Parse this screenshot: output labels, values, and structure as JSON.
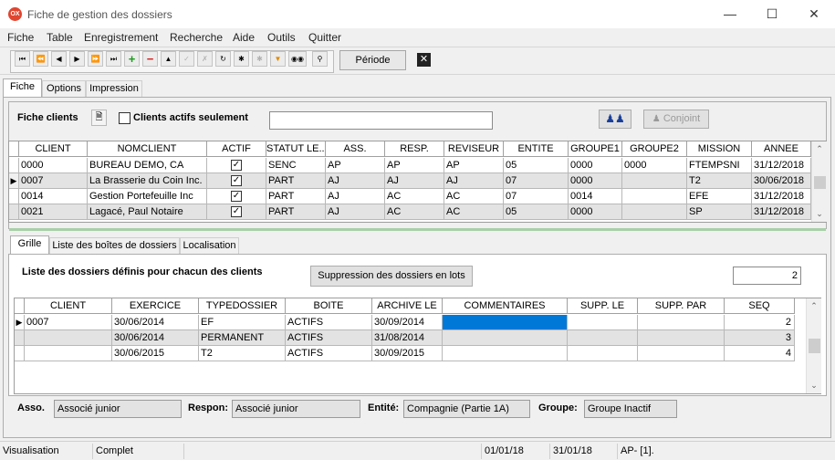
{
  "window": {
    "title": "Fiche de gestion des dossiers",
    "app_icon_text": "OX"
  },
  "menu": [
    "Fiche",
    "Table",
    "Enregistrement",
    "Recherche",
    "Aide",
    "Outils",
    "Quitter"
  ],
  "toolbar": {
    "periode_label": "Période",
    "buttons": [
      "first-icon",
      "prev-page-icon",
      "prev-icon",
      "next-icon",
      "next-page-icon",
      "last-icon",
      "add-icon",
      "delete-icon",
      "up-icon",
      "confirm-icon",
      "cancel-icon",
      "refresh-icon",
      "star-icon",
      "star-disabled-icon",
      "filter-icon",
      "binoculars-icon",
      "search-icon"
    ]
  },
  "top_tabs": [
    "Fiche",
    "Options",
    "Impression"
  ],
  "clients_panel": {
    "title": "Fiche clients",
    "actifs_label": "Clients actifs seulement",
    "conjoint_label": "Conjoint",
    "columns": [
      "CLIENT",
      "NOMCLIENT",
      "ACTIF",
      "STATUT LE...",
      "ASS.",
      "RESP.",
      "REVISEUR",
      "ENTITE",
      "GROUPE1",
      "GROUPE2",
      "MISSION",
      "ANNEE"
    ],
    "rows": [
      {
        "client": "0000",
        "nom": "BUREAU DEMO, CA",
        "actif": true,
        "statut": "SENC",
        "ass": "AP",
        "resp": "AP",
        "rev": "AP",
        "entite": "05",
        "groupe1": "0000",
        "groupe2": "0000",
        "mission": "FTEMPSNI",
        "annee": "31/12/2018"
      },
      {
        "client": "0007",
        "nom": "La Brasserie du Coin Inc.",
        "actif": true,
        "statut": "PART",
        "ass": "AJ",
        "resp": "AJ",
        "rev": "AJ",
        "entite": "07",
        "groupe1": "0000",
        "groupe2": "",
        "mission": "T2",
        "annee": "30/06/2018"
      },
      {
        "client": "0014",
        "nom": "Gestion Portefeuille Inc",
        "actif": true,
        "statut": "PART",
        "ass": "AJ",
        "resp": "AC",
        "rev": "AC",
        "entite": "07",
        "groupe1": "0014",
        "groupe2": "",
        "mission": "EFE",
        "annee": "31/12/2018"
      },
      {
        "client": "0021",
        "nom": "Lagacé, Paul Notaire",
        "actif": true,
        "statut": "PART",
        "ass": "AJ",
        "resp": "AC",
        "rev": "AC",
        "entite": "05",
        "groupe1": "0000",
        "groupe2": "",
        "mission": "SP",
        "annee": "31/12/2018"
      }
    ]
  },
  "bottom_tabs": [
    "Grille",
    "Liste des boîtes de dossiers",
    "Localisation"
  ],
  "dossiers_panel": {
    "title": "Liste des dossiers définis pour chacun des clients",
    "suppression_label": "Suppression des dossiers en lots",
    "count_value": "2",
    "columns": [
      "CLIENT",
      "EXERCICE",
      "TYPEDOSSIER",
      "BOITE",
      "ARCHIVE LE",
      "COMMENTAIRES",
      "SUPP. LE",
      "SUPP. PAR",
      "SEQ"
    ],
    "rows": [
      {
        "client": "0007",
        "exercice": "30/06/2014",
        "type": "EF",
        "boite": "ACTIFS",
        "archive": "30/09/2014",
        "comm": "",
        "supp_le": "",
        "supp_par": "",
        "seq": "2"
      },
      {
        "client": "",
        "exercice": "30/06/2014",
        "type": "PERMANENT",
        "boite": "ACTIFS",
        "archive": "31/08/2014",
        "comm": "",
        "supp_le": "",
        "supp_par": "",
        "seq": "3"
      },
      {
        "client": "",
        "exercice": "30/06/2015",
        "type": "T2",
        "boite": "ACTIFS",
        "archive": "30/09/2015",
        "comm": "",
        "supp_le": "",
        "supp_par": "",
        "seq": "4"
      }
    ]
  },
  "details": {
    "asso_label": "Asso.",
    "asso_value": "Associé junior",
    "respon_label": "Respon:",
    "respon_value": "Associé junior",
    "entite_label": "Entité:",
    "entite_value": "Compagnie (Partie 1A)",
    "groupe_label": "Groupe:",
    "groupe_value": "Groupe Inactif"
  },
  "status": {
    "mode": "Visualisation",
    "state": "Complet",
    "date1": "01/01/18",
    "date2": "31/01/18",
    "user": "AP- [1]."
  },
  "colors": {
    "selection": "#0078d7",
    "alt_row": "#e3e3e3",
    "separator": "#a9cfa9"
  }
}
